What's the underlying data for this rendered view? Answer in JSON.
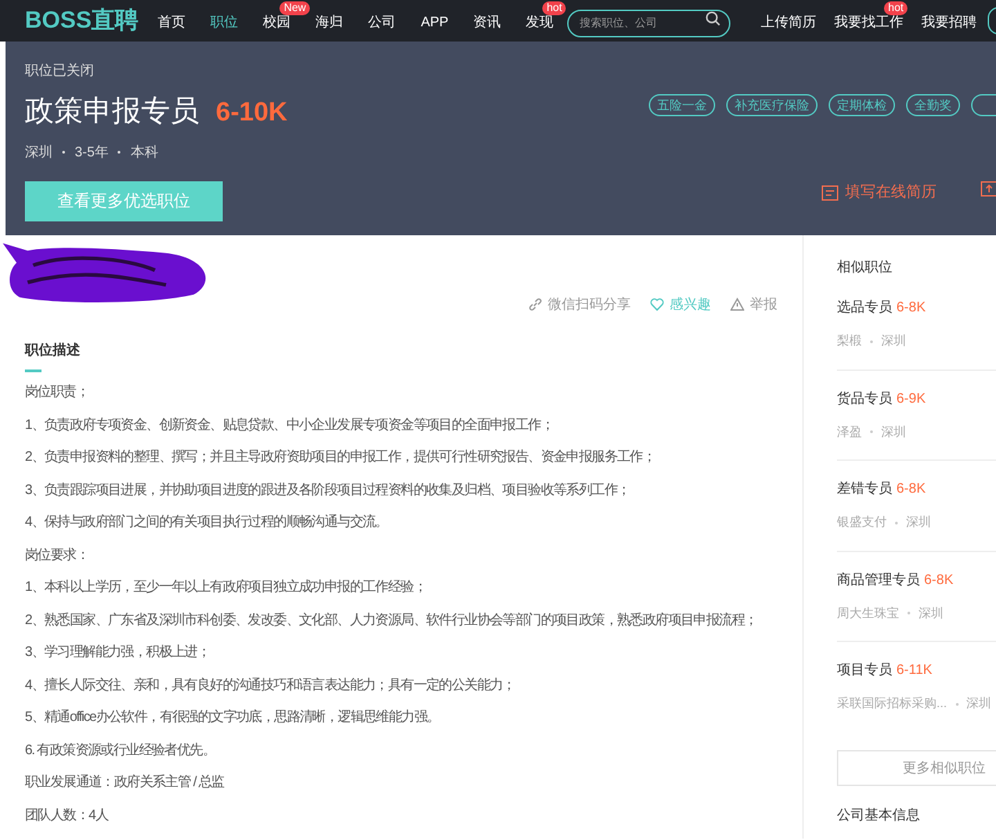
{
  "nav": {
    "logo": "BOSS直聘",
    "items": [
      {
        "label": "首页",
        "selected": false
      },
      {
        "label": "职位",
        "selected": true
      },
      {
        "label": "校园",
        "selected": false,
        "badge": "New"
      },
      {
        "label": "海归",
        "selected": false
      },
      {
        "label": "公司",
        "selected": false
      },
      {
        "label": "APP",
        "selected": false
      },
      {
        "label": "资讯",
        "selected": false
      },
      {
        "label": "发现",
        "selected": false,
        "badge": "hot"
      }
    ],
    "search": {
      "placeholder": "搜索职位、公司"
    },
    "right_items": [
      {
        "label": "上传简历"
      },
      {
        "label": "我要找工作",
        "badge": "hot"
      },
      {
        "label": "我要招聘"
      }
    ]
  },
  "header": {
    "status": "职位已关闭",
    "title": "政策申报专员",
    "salary": "6-10K",
    "meta": [
      "深圳",
      "3-5年",
      "本科"
    ],
    "tags": [
      "五险一金",
      "补充医疗保险",
      "定期体检",
      "全勤奖"
    ],
    "primary_button": "查看更多优选职位",
    "resume_link": "填写在线简历"
  },
  "actions": [
    {
      "kind": "share",
      "label": "微信扫码分享"
    },
    {
      "kind": "interest",
      "label": "感兴趣"
    },
    {
      "kind": "report",
      "label": "举报"
    }
  ],
  "description": {
    "heading": "职位描述",
    "lines": [
      "岗位职责；",
      "1、负责政府专项资金、创新资金、贴息贷款、中小企业发展专项资金等项目的全面申报工作；",
      "2、负责申报资料的整理、撰写；并且主导政府资助项目的申报工作，提供可行性研究报告、资金申报服务工作；",
      "3、负责跟踪项目进展，并协助项目进度的跟进及各阶段项目过程资料的收集及归档、项目验收等系列工作；",
      "4、保持与政府部门之间的有关项目执行过程的顺畅沟通与交流。",
      "岗位要求：",
      "1、本科以上学历，至少一年以上有政府项目独立成功申报的工作经验；",
      "2、熟悉国家、广东省及深圳市科创委、发改委、文化部、人力资源局、软件行业协会等部门的项目政策，熟悉政府项目申报流程；",
      "3、学习理解能力强，积极上进；",
      "4、擅长人际交往、亲和，具有良好的沟通技巧和语言表达能力；具有一定的公关能力；",
      "5、精通office办公软件，有很强的文字功底，思路清晰，逻辑思维能力强。",
      "6. 有政策资源或行业经验者优先。",
      "职业发展通道：政府关系主管 / 总监",
      "团队人数：4人"
    ]
  },
  "similar": {
    "heading": "相似职位",
    "items": [
      {
        "title": "选品专员",
        "salary": "6-8K",
        "company": "梨椴",
        "city": "深圳"
      },
      {
        "title": "货品专员",
        "salary": "6-9K",
        "company": "泽盈",
        "city": "深圳"
      },
      {
        "title": "差错专员",
        "salary": "6-8K",
        "company": "银盛支付",
        "city": "深圳"
      },
      {
        "title": "商品管理专员",
        "salary": "6-8K",
        "company": "周大生珠宝",
        "city": "深圳"
      },
      {
        "title": "项目专员",
        "salary": "6-11K",
        "company": "采联国际招标采购...",
        "city": "深圳"
      }
    ],
    "more_button": "更多相似职位",
    "next_heading": "公司基本信息"
  }
}
